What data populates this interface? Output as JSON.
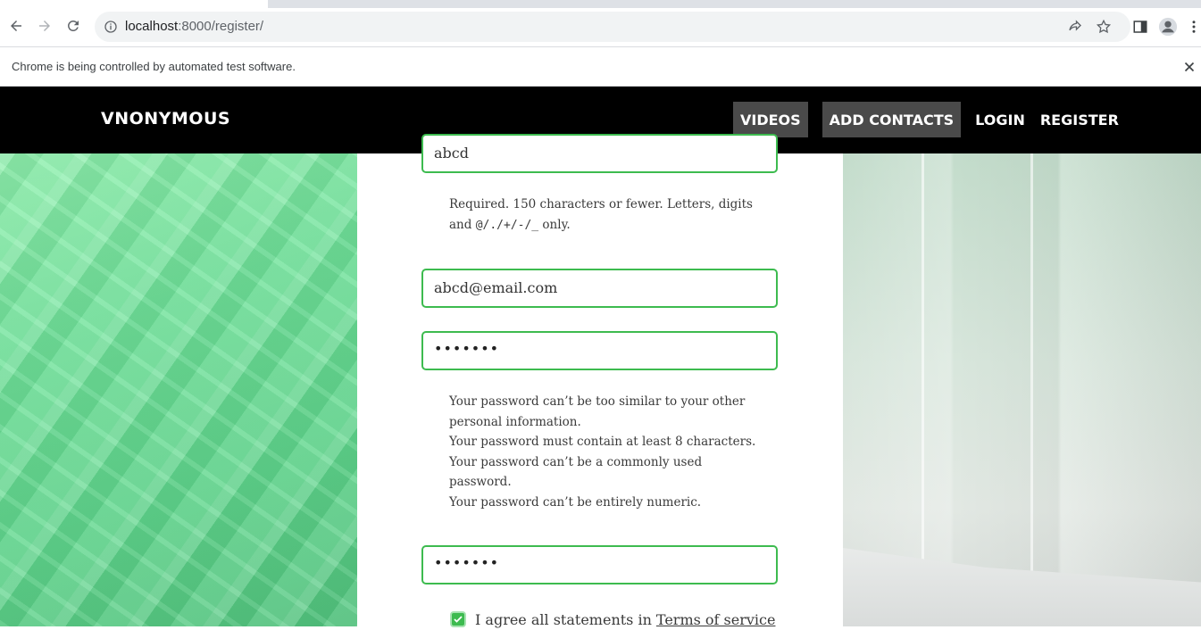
{
  "browser": {
    "url_host": "localhost",
    "url_rest": ":8000/register/",
    "infobar_message": "Chrome is being controlled by automated test software."
  },
  "site": {
    "brand": "VNONYMOUS",
    "nav": [
      {
        "label": "VIDEOS",
        "style": "boxed"
      },
      {
        "label": "ADD CONTACTS",
        "style": "boxed"
      },
      {
        "label": "LOGIN",
        "style": "plain"
      },
      {
        "label": "REGISTER",
        "style": "plain"
      }
    ]
  },
  "form": {
    "username_value": "abcd",
    "username_help_line1": "Required. 150 characters or fewer. Letters, digits",
    "username_help_line2_prefix": "and ",
    "username_help_line2_mono": "@/./+/-/_",
    "username_help_line2_suffix": " only.",
    "email_value": "abcd@email.com",
    "password_mask": "•••••••",
    "password_help": [
      "Your password can’t be too similar to your other",
      "personal information.",
      "Your password must contain at least 8 characters.",
      "Your password can’t be a commonly used",
      "password.",
      "Your password can’t be entirely numeric."
    ],
    "password_confirm_mask": "•••••••",
    "terms_checked": true,
    "terms_label": "I agree all statements in",
    "terms_link": "Terms of service"
  },
  "colors": {
    "accent_green": "#3dbb4f",
    "nav_bg": "#000000",
    "nav_box": "#4a4a4a"
  }
}
